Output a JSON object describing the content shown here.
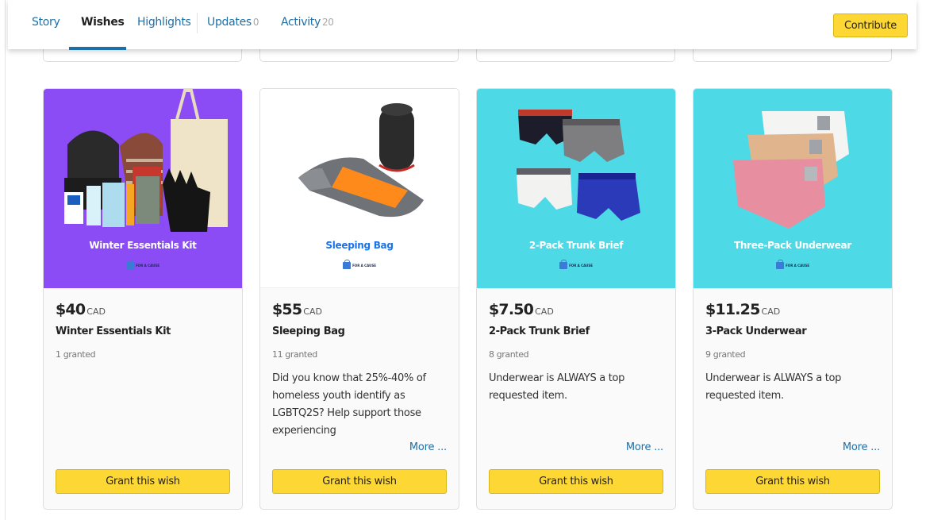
{
  "nav": {
    "tabs": [
      {
        "label": "Story",
        "count": ""
      },
      {
        "label": "Wishes",
        "count": ""
      },
      {
        "label": "Highlights",
        "count": ""
      },
      {
        "label": "Updates",
        "count": "0"
      },
      {
        "label": "Activity",
        "count": "20"
      }
    ],
    "active_tab": "Wishes",
    "contribute_label": "Contribute"
  },
  "brand": {
    "badge_text": "FOR A CAUSE",
    "accent": "#fdd835",
    "link_color": "#1d6fa8"
  },
  "cards": [
    {
      "image_title": "Winter Essentials Kit",
      "image_bg": "#8b4bf5",
      "price": "$40",
      "currency": "CAD",
      "name": "Winter Essentials Kit",
      "granted": "1 granted",
      "description": "",
      "more": "",
      "button": "Grant this wish"
    },
    {
      "image_title": "Sleeping Bag",
      "image_bg": "#ffffff",
      "price": "$55",
      "currency": "CAD",
      "name": "Sleeping Bag",
      "granted": "11 granted",
      "description": "Did you know that 25%-40% of homeless youth identify as LGBTQ2S? Help support those experiencing",
      "more": "More ...",
      "button": "Grant this wish"
    },
    {
      "image_title": "2-Pack Trunk Brief",
      "image_bg": "#4dd9e6",
      "price": "$7.50",
      "currency": "CAD",
      "name": "2-Pack Trunk Brief",
      "granted": "8 granted",
      "description": "Underwear is ALWAYS a top requested item.",
      "more": "More ...",
      "button": "Grant this wish"
    },
    {
      "image_title": "Three-Pack Underwear",
      "image_bg": "#4dd9e6",
      "price": "$11.25",
      "currency": "CAD",
      "name": "3-Pack Underwear",
      "granted": "9 granted",
      "description": "Underwear is ALWAYS a top requested item.",
      "more": "More ...",
      "button": "Grant this wish"
    }
  ]
}
